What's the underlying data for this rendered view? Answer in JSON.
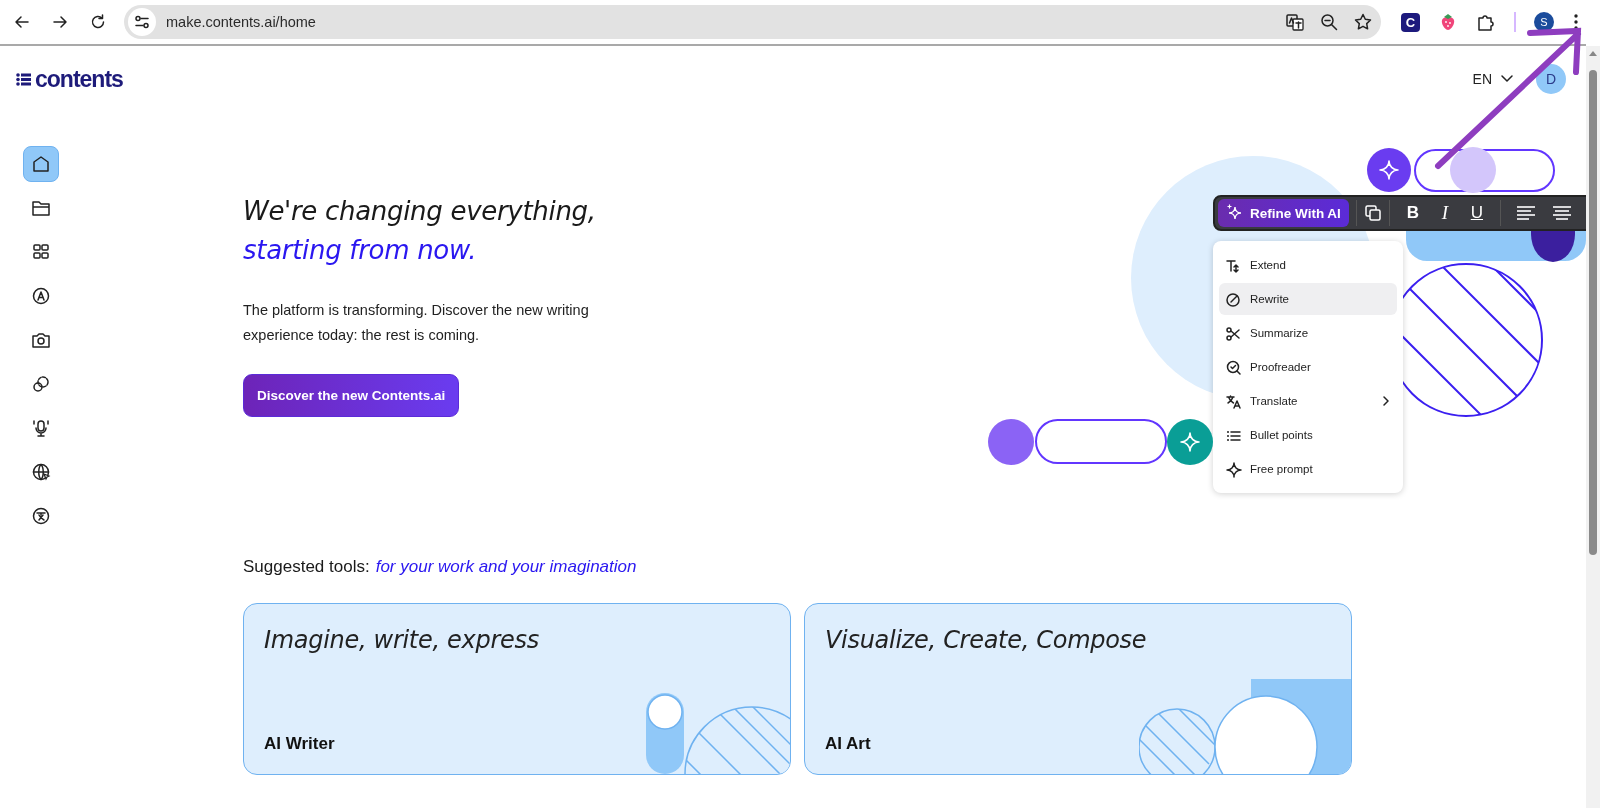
{
  "browser": {
    "url": "make.contents.ai/home",
    "extension_initial": "C",
    "profile_initial": "S"
  },
  "header": {
    "logo": "contents",
    "language": "EN",
    "avatar_initial": "D"
  },
  "sidebar": {
    "items": [
      {
        "kind": "home",
        "selected": true
      },
      {
        "kind": "folder",
        "selected": false
      },
      {
        "kind": "grid",
        "selected": false
      },
      {
        "kind": "letter",
        "selected": false
      },
      {
        "kind": "camera",
        "selected": false
      },
      {
        "kind": "chat",
        "selected": false
      },
      {
        "kind": "mic",
        "selected": false
      },
      {
        "kind": "globe",
        "selected": false
      },
      {
        "kind": "translate",
        "selected": false
      }
    ]
  },
  "hero": {
    "title": "We're changing everything,",
    "subtitle": "starting from now.",
    "body": "The platform is transforming. Discover the new writing experience today: the rest is coming.",
    "button": "Discover the new Contents.ai"
  },
  "toolbar": {
    "refine": "Refine With AI",
    "bold": "B",
    "italic": "I",
    "underline": "U"
  },
  "menu": {
    "items": [
      {
        "kind": "extend",
        "label": "Extend",
        "selected": false,
        "submenu": false
      },
      {
        "kind": "rewrite",
        "label": "Rewrite",
        "selected": true,
        "submenu": false
      },
      {
        "kind": "summarize",
        "label": "Summarize",
        "selected": false,
        "submenu": false
      },
      {
        "kind": "proofread",
        "label": "Proofreader",
        "selected": false,
        "submenu": false
      },
      {
        "kind": "translate",
        "label": "Translate",
        "selected": false,
        "submenu": true
      },
      {
        "kind": "bullets",
        "label": "Bullet points",
        "selected": false,
        "submenu": false
      },
      {
        "kind": "prompt",
        "label": "Free prompt",
        "selected": false,
        "submenu": false
      }
    ]
  },
  "suggested": {
    "label": "Suggested tools:",
    "tagline": "for your work and your imagination"
  },
  "cards": [
    {
      "kind": "writer",
      "tagline": "Imagine, write, express",
      "name": "AI Writer"
    },
    {
      "kind": "art",
      "tagline": "Visualize, Create, Compose",
      "name": "AI Art"
    }
  ]
}
